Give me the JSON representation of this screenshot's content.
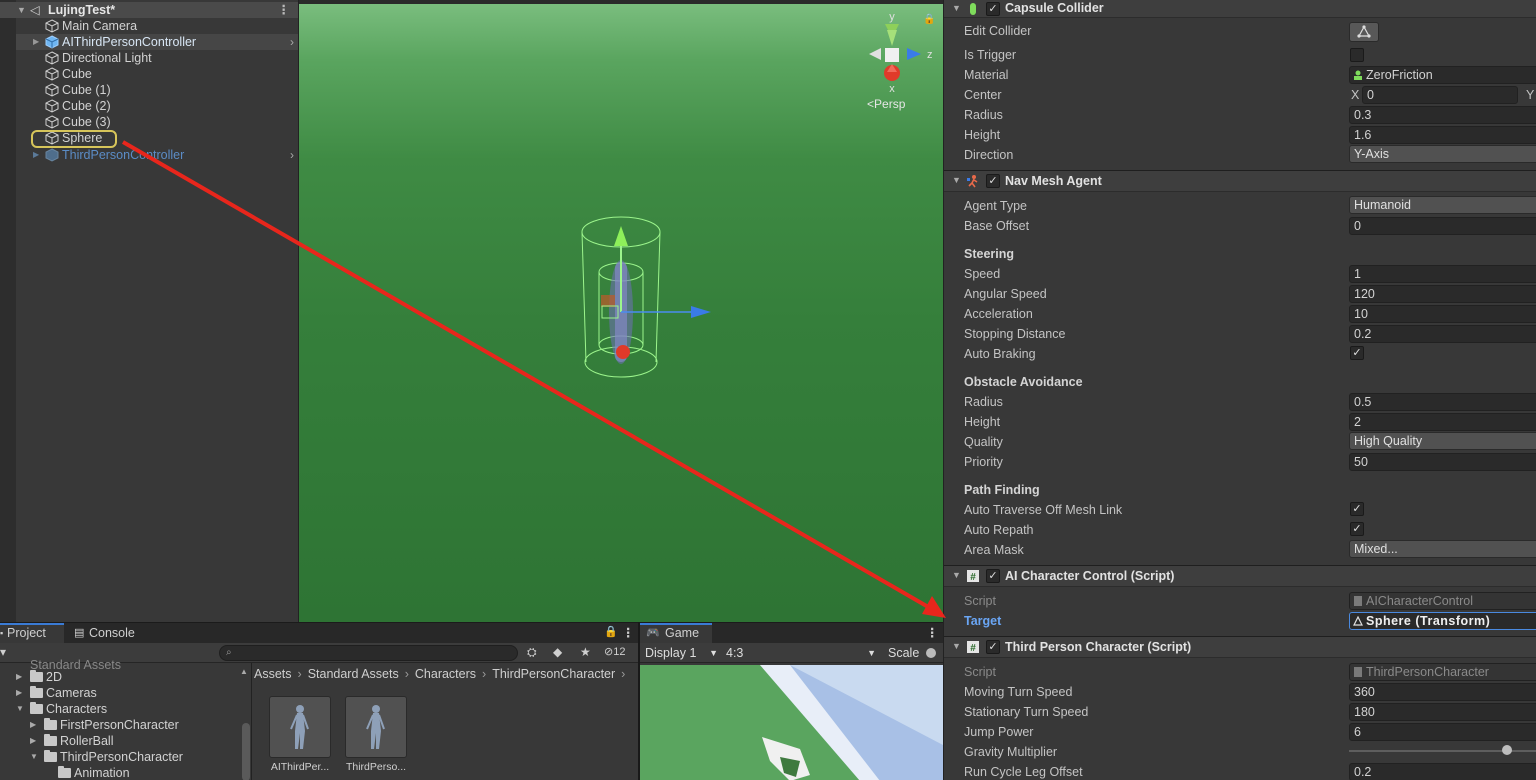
{
  "hierarchy": {
    "scene_name": "LujingTest*",
    "items": [
      {
        "label": "Main Camera"
      },
      {
        "label": "AIThirdPersonController"
      },
      {
        "label": "Directional Light"
      },
      {
        "label": "Cube"
      },
      {
        "label": "Cube (1)"
      },
      {
        "label": "Cube (2)"
      },
      {
        "label": "Cube (3)"
      },
      {
        "label": "Sphere"
      },
      {
        "label": "ThirdPersonController"
      }
    ]
  },
  "scene_view": {
    "gizmo_axes": {
      "y": "y",
      "z": "z",
      "x": "x"
    },
    "projection_label": "Persp"
  },
  "inspector": {
    "capsule_collider": {
      "title": "Capsule Collider",
      "edit_collider": "Edit Collider",
      "is_trigger": "Is Trigger",
      "material_label": "Material",
      "material_value": "ZeroFriction",
      "center_label": "Center",
      "center_x_label": "X",
      "center_x": "0",
      "center_y_label": "Y",
      "radius_label": "Radius",
      "radius": "0.3",
      "height_label": "Height",
      "height": "1.6",
      "direction_label": "Direction",
      "direction": "Y-Axis"
    },
    "nav_mesh_agent": {
      "title": "Nav Mesh Agent",
      "agent_type_label": "Agent Type",
      "agent_type": "Humanoid",
      "base_offset_label": "Base Offset",
      "base_offset": "0",
      "steering": "Steering",
      "speed_label": "Speed",
      "speed": "1",
      "angular_speed_label": "Angular Speed",
      "angular_speed": "120",
      "acceleration_label": "Acceleration",
      "acceleration": "10",
      "stopping_distance_label": "Stopping Distance",
      "stopping_distance": "0.2",
      "auto_braking_label": "Auto Braking",
      "obstacle_avoidance": "Obstacle Avoidance",
      "oa_radius_label": "Radius",
      "oa_radius": "0.5",
      "oa_height_label": "Height",
      "oa_height": "2",
      "quality_label": "Quality",
      "quality": "High Quality",
      "priority_label": "Priority",
      "priority": "50",
      "path_finding": "Path Finding",
      "auto_traverse_label": "Auto Traverse Off Mesh Link",
      "auto_repath_label": "Auto Repath",
      "area_mask_label": "Area Mask",
      "area_mask": "Mixed..."
    },
    "ai_character_control": {
      "title": "AI Character Control (Script)",
      "script_label": "Script",
      "script_value": "AICharacterControl",
      "target_label": "Target",
      "target_value": "Sphere (Transform)"
    },
    "third_person_character": {
      "title": "Third Person Character (Script)",
      "script_label": "Script",
      "script_value": "ThirdPersonCharacter",
      "moving_turn_speed_label": "Moving Turn Speed",
      "moving_turn_speed": "360",
      "stationary_turn_speed_label": "Stationary Turn Speed",
      "stationary_turn_speed": "180",
      "jump_power_label": "Jump Power",
      "jump_power": "6",
      "gravity_multiplier_label": "Gravity Multiplier",
      "run_cycle_leg_offset_label": "Run Cycle Leg Offset",
      "run_cycle_leg_offset": "0.2"
    }
  },
  "project": {
    "tabs": [
      "Project",
      "Console"
    ],
    "hidden_count": "12",
    "tree": [
      {
        "label": "Standard Assets"
      },
      {
        "label": "2D"
      },
      {
        "label": "Cameras"
      },
      {
        "label": "Characters"
      },
      {
        "label": "FirstPersonCharacter"
      },
      {
        "label": "RollerBall"
      },
      {
        "label": "ThirdPersonCharacter"
      },
      {
        "label": "Animation"
      }
    ],
    "breadcrumb": [
      "Assets",
      "Standard Assets",
      "Characters",
      "ThirdPersonCharacter"
    ],
    "assets": [
      {
        "label": "AIThirdPer..."
      },
      {
        "label": "ThirdPerso..."
      }
    ]
  },
  "game": {
    "tab": "Game",
    "display": "Display 1",
    "aspect": "4:3",
    "scale_label": "Scale"
  },
  "colors": {
    "selection_accent": "#3a7bd5",
    "annotation_arrow": "#e8261c",
    "highlight_circle": "#d7c55a",
    "ground": "#357f3b"
  }
}
